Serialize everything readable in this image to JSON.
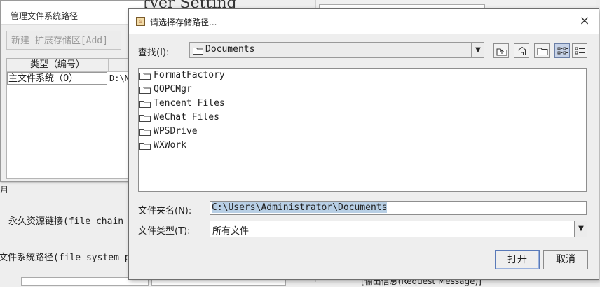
{
  "background_app": {
    "title": "服务类设置 Server Setting",
    "label_j": "月",
    "permanent_link_label": "永久资源链接(file chain",
    "fs_path_label": "文件系统路径(file system p",
    "output_label": "[输出信息(Request Message)]"
  },
  "manager_window": {
    "title": "管理文件系统路径",
    "add_button_label": "新建 扩展存储区[Add]",
    "table": {
      "header": "类型（编号）",
      "rows": [
        {
          "type": "主文件系统（0）",
          "path": "D:\\N"
        }
      ]
    }
  },
  "dialog": {
    "title": "请选择存储路径...",
    "look_in_label": "查找(I):",
    "look_in_value": "Documents",
    "toolbar_icons": [
      "up-folder-icon",
      "home-icon",
      "new-folder-icon",
      "list-view-icon",
      "details-view-icon"
    ],
    "files": [
      "FormatFactory",
      "QQPCMgr",
      "Tencent Files",
      "WeChat Files",
      "WPSDrive",
      "WXWork"
    ],
    "folder_name_label": "文件夹名(N):",
    "folder_name_value": "C:\\Users\\Administrator\\Documents",
    "file_type_label": "文件类型(T):",
    "file_type_value": "所有文件",
    "open_label": "打开",
    "cancel_label": "取消",
    "close_glyph": "×"
  }
}
